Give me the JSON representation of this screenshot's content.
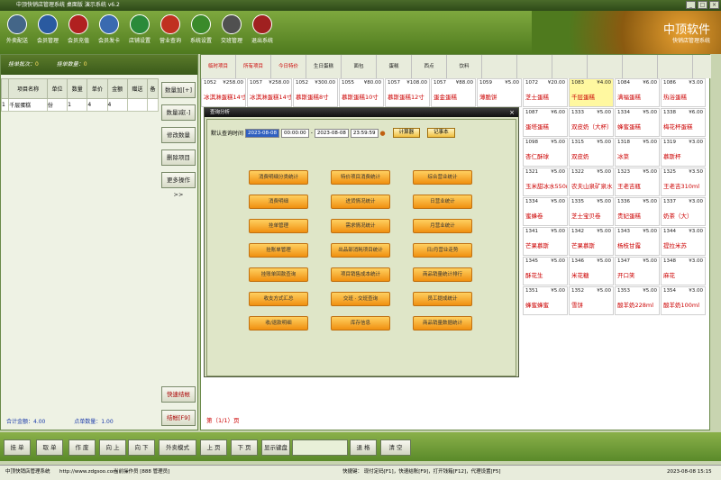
{
  "title": "中顶快销店管理系统 桌面版 演示系统 v6.2",
  "toolbar": [
    {
      "label": "外卖配送",
      "color": "#446688"
    },
    {
      "label": "会员管理",
      "color": "#2a5aa0"
    },
    {
      "label": "会员充值",
      "color": "#b02020"
    },
    {
      "label": "会员发卡",
      "color": "#3a6ab0"
    },
    {
      "label": "店铺设置",
      "color": "#2a8a3a"
    },
    {
      "label": "营业查询",
      "color": "#c03020"
    },
    {
      "label": "系统设置",
      "color": "#3a8a2a"
    },
    {
      "label": "交班管理",
      "color": "#505050"
    },
    {
      "label": "退出系统",
      "color": "#a02020"
    }
  ],
  "brand": {
    "title": "中顶软件",
    "subtitle": "快销店管理系统"
  },
  "left": {
    "status_waiting": "挂单批次：",
    "status_waiting_val": "0",
    "status_count": "挂单数量：",
    "status_count_val": "0",
    "headers": [
      "",
      "项目名称",
      "单位",
      "数量",
      "单价",
      "金额",
      "赠送",
      "备"
    ],
    "rows": [
      [
        "1",
        "千层蛋糕",
        "份",
        "1",
        "4",
        "4",
        "",
        ""
      ]
    ],
    "total_amount": "合计金额：4.00",
    "total_qty": "点单数量：1.00"
  },
  "sidebtns": [
    "数量加[+]",
    "数量减[-]",
    "修改数量",
    "删除项目",
    "更多操作>>"
  ],
  "quick": [
    "快速结帐",
    "结帐[F9]"
  ],
  "cats": [
    {
      "label": "临时项目",
      "red": true
    },
    {
      "label": "所有项目",
      "red": true
    },
    {
      "label": "今日特价",
      "red": true
    },
    {
      "label": "生日蛋糕",
      "red": false
    },
    {
      "label": "面包",
      "red": false
    },
    {
      "label": "蛋糕",
      "red": false
    },
    {
      "label": "西点",
      "red": false
    },
    {
      "label": "饮料",
      "red": false
    },
    {
      "label": "",
      "red": false
    },
    {
      "label": "",
      "red": false
    },
    {
      "label": "",
      "red": false
    },
    {
      "label": "",
      "red": false
    },
    {
      "label": "",
      "red": false
    },
    {
      "label": "",
      "red": false
    }
  ],
  "products": [
    [
      "1052",
      "¥258.00",
      "冰淇淋蛋糕14寸",
      false
    ],
    [
      "1057",
      "¥258.00",
      "冰淇淋蛋糕14寸",
      false
    ],
    [
      "1052",
      "¥300.00",
      "慕斯蛋糕8寸",
      false
    ],
    [
      "1055",
      "¥80.00",
      "慕斯蛋糕10寸",
      false
    ],
    [
      "1057",
      "¥108.00",
      "慕斯蛋糕12寸",
      false
    ],
    [
      "1057",
      "¥88.00",
      "蛋金蛋糕",
      false
    ],
    [
      "1059",
      "¥5.00",
      "薄脆饼",
      false
    ],
    [
      "1072",
      "¥20.00",
      "芝士蛋糕",
      false
    ],
    [
      "1083",
      "¥4.00",
      "千层蛋糕",
      true
    ],
    [
      "1084",
      "¥6.00",
      "满福蛋糕",
      false
    ],
    [
      "1086",
      "¥3.00",
      "热浴蛋糕",
      false
    ],
    [
      "",
      "",
      "",
      false
    ],
    [
      "",
      "",
      "",
      false
    ],
    [
      "",
      "",
      "",
      false
    ],
    [
      "",
      "",
      "",
      false
    ],
    [
      "",
      "",
      "",
      false
    ],
    [
      "",
      "",
      "",
      false
    ],
    [
      "",
      "",
      "",
      false
    ],
    [
      "1087",
      "¥6.00",
      "蛋塔蛋糕",
      false
    ],
    [
      "1333",
      "¥5.00",
      "双皮奶（大杯）",
      false
    ],
    [
      "1334",
      "¥5.00",
      "蜂蜜蛋糕",
      false
    ],
    [
      "1338",
      "¥6.00",
      "梅花杯蛋糕",
      false
    ],
    [
      "",
      "",
      "",
      false
    ],
    [
      "",
      "",
      "",
      false
    ],
    [
      "",
      "",
      "",
      false
    ],
    [
      "",
      "",
      "",
      false
    ],
    [
      "",
      "",
      "",
      false
    ],
    [
      "",
      "",
      "",
      false
    ],
    [
      "",
      "",
      "",
      false
    ],
    [
      "1098",
      "¥5.00",
      "杏仁酥球",
      false
    ],
    [
      "1315",
      "¥5.00",
      "双皮奶",
      false
    ],
    [
      "1318",
      "¥5.00",
      "冰菜",
      false
    ],
    [
      "1319",
      "¥3.00",
      "慕斯杯",
      false
    ],
    [
      "",
      "",
      "",
      false
    ],
    [
      "",
      "",
      "",
      false
    ],
    [
      "",
      "",
      "",
      false
    ],
    [
      "",
      "",
      "",
      false
    ],
    [
      "",
      "",
      "",
      false
    ],
    [
      "",
      "",
      "",
      false
    ],
    [
      "",
      "",
      "",
      false
    ],
    [
      "1321",
      "¥5.00",
      "玉米甜冰水550ml",
      false
    ],
    [
      "1322",
      "¥5.00",
      "农夫山泉矿泉水",
      false
    ],
    [
      "1323",
      "¥5.00",
      "王老吉瓶",
      false
    ],
    [
      "1325",
      "¥3.50",
      "王老吉310ml",
      false
    ],
    [
      "",
      "",
      "",
      false
    ],
    [
      "",
      "",
      "",
      false
    ],
    [
      "",
      "",
      "",
      false
    ],
    [
      "",
      "",
      "",
      false
    ],
    [
      "",
      "",
      "",
      false
    ],
    [
      "",
      "",
      "",
      false
    ],
    [
      "",
      "",
      "",
      false
    ],
    [
      "1334",
      "¥5.00",
      "蜜蜂卷",
      false
    ],
    [
      "1335",
      "¥5.00",
      "芝士宝贝卷",
      false
    ],
    [
      "1336",
      "¥5.00",
      "贵妃蛋糕",
      false
    ],
    [
      "1337",
      "¥3.00",
      "奶茶（大）",
      false
    ],
    [
      "",
      "",
      "",
      false
    ],
    [
      "",
      "",
      "",
      false
    ],
    [
      "",
      "",
      "",
      false
    ],
    [
      "",
      "",
      "",
      false
    ],
    [
      "",
      "",
      "",
      false
    ],
    [
      "",
      "",
      "",
      false
    ],
    [
      "",
      "",
      "",
      false
    ],
    [
      "1341",
      "¥5.00",
      "芒果慕斯",
      false
    ],
    [
      "1342",
      "¥5.00",
      "芒果慕斯",
      false
    ],
    [
      "1343",
      "¥5.00",
      "杨枝甘露",
      false
    ],
    [
      "1344",
      "¥3.00",
      "提拉米苏",
      false
    ],
    [
      "",
      "",
      "",
      false
    ],
    [
      "",
      "",
      "",
      false
    ],
    [
      "",
      "",
      "",
      false
    ],
    [
      "",
      "",
      "",
      false
    ],
    [
      "",
      "",
      "",
      false
    ],
    [
      "",
      "",
      "",
      false
    ],
    [
      "",
      "",
      "",
      false
    ],
    [
      "1345",
      "¥5.00",
      "酥花生",
      false
    ],
    [
      "1346",
      "¥5.00",
      "米花糖",
      false
    ],
    [
      "1347",
      "¥5.00",
      "开口笑",
      false
    ],
    [
      "1348",
      "¥3.00",
      "麻花",
      false
    ],
    [
      "",
      "",
      "",
      false
    ],
    [
      "",
      "",
      "",
      false
    ],
    [
      "",
      "",
      "",
      false
    ],
    [
      "",
      "",
      "",
      false
    ],
    [
      "",
      "",
      "",
      false
    ],
    [
      "",
      "",
      "",
      false
    ],
    [
      "",
      "",
      "",
      false
    ],
    [
      "1351",
      "¥5.00",
      "蜂蜜蜂蜜",
      false
    ],
    [
      "1352",
      "¥5.00",
      "雪饼",
      false
    ],
    [
      "1353",
      "¥5.00",
      "酸羊奶228ml",
      false
    ],
    [
      "1354",
      "¥3.00",
      "酸羊奶100ml",
      false
    ]
  ],
  "page_label": "第（1/1）页",
  "dialog": {
    "title": "查询分析",
    "date_label": "默认查询时间",
    "date_from": "2023-08-08",
    "time_from": "00:00:00",
    "sep": "-",
    "date_to": "2023-08-08",
    "time_to": "23:59:59",
    "calc": "计算器",
    "note": "记事本",
    "buttons": [
      [
        "消费明细分类统计",
        "特价项目消费统计",
        "综合营业统计"
      ],
      [
        "消费明细",
        "进货情况统计",
        "日营业统计"
      ],
      [
        "挂单管理",
        "需求情况统计",
        "月营业统计"
      ],
      [
        "挂账单管理",
        "出品部消耗项目统计",
        "日/月营业走势"
      ],
      [
        "挂账单回款查询",
        "项目销售成本统计",
        "商品销量统计排行"
      ],
      [
        "收支方式汇总",
        "交班 · 交班查询",
        "员工提成统计"
      ],
      [
        "收/退款明细",
        "库存信息",
        "商品销量数据统计"
      ]
    ]
  },
  "bottom": [
    "挂 单",
    "取 单",
    "作 废",
    "向 上",
    "向 下",
    "外卖模式",
    "上 页",
    "下 页",
    "显示键盘",
    "",
    "退 格",
    "清 空"
  ],
  "status": {
    "app": "中顶快销店管理系统",
    "url": "http://www.zdgsoo.com",
    "operator": "当前操作员 [888 管理员]",
    "shortcuts": "快捷键：  现付定码[F1]，快速结账[F9]，打开钱箱[F12]，代理设置[F5]",
    "datetime": "2023-08-08 15:15"
  }
}
